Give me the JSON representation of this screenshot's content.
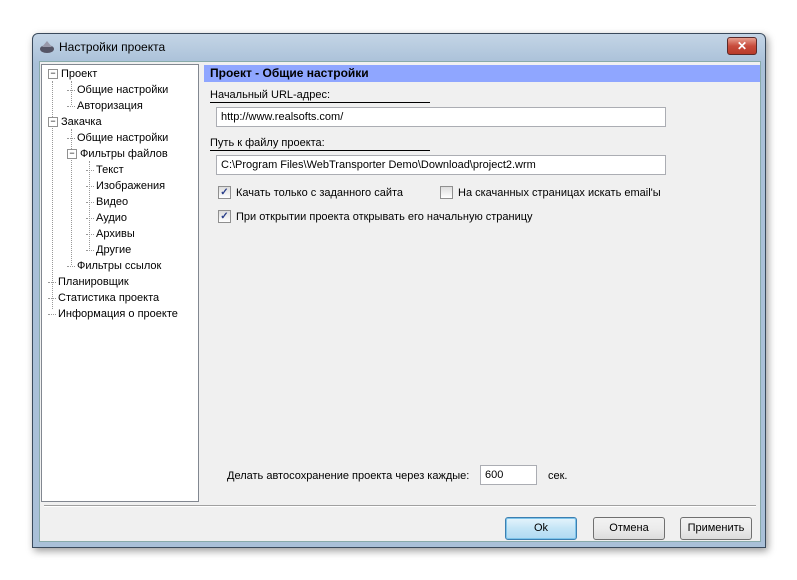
{
  "window": {
    "title": "Настройки проекта",
    "close": "✕"
  },
  "tree": {
    "items": [
      {
        "label": "Проект",
        "level": 0,
        "expander": "−"
      },
      {
        "label": "Общие настройки",
        "level": 1
      },
      {
        "label": "Авторизация",
        "level": 1
      },
      {
        "label": "Закачка",
        "level": 0,
        "expander": "−"
      },
      {
        "label": "Общие настройки",
        "level": 1
      },
      {
        "label": "Фильтры файлов",
        "level": 1,
        "expander": "−"
      },
      {
        "label": "Текст",
        "level": 2
      },
      {
        "label": "Изображения",
        "level": 2
      },
      {
        "label": "Видео",
        "level": 2
      },
      {
        "label": "Аудио",
        "level": 2
      },
      {
        "label": "Архивы",
        "level": 2
      },
      {
        "label": "Другие",
        "level": 2
      },
      {
        "label": "Фильтры ссылок",
        "level": 1
      },
      {
        "label": "Планировщик",
        "level": 0
      },
      {
        "label": "Статистика проекта",
        "level": 0
      },
      {
        "label": "Информация о проекте",
        "level": 0
      }
    ]
  },
  "panel": {
    "header": "Проект - Общие настройки",
    "url_label": "Начальный URL-адрес:",
    "url_value": "http://www.realsofts.com/",
    "path_label": "Путь к файлу проекта:",
    "path_value": "C:\\Program Files\\WebTransporter Demo\\Download\\project2.wrm",
    "cb1": {
      "label": "Качать только с заданного сайта",
      "checked": true
    },
    "cb2": {
      "label": "На скачанных страницах искать email'ы",
      "checked": false
    },
    "cb3": {
      "label": "При открытии проекта открывать его начальную страницу",
      "checked": true
    },
    "autosave_label": "Делать автосохранение проекта через каждые:",
    "autosave_value": "600",
    "autosave_unit": "сек."
  },
  "buttons": {
    "ok": "Ok",
    "cancel": "Отмена",
    "apply": "Применить"
  },
  "colors": {
    "header_bg": "#8fa6ff"
  }
}
